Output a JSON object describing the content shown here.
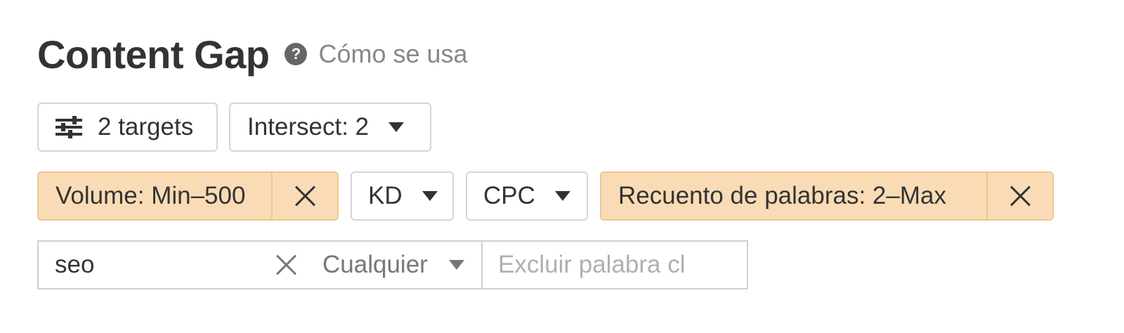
{
  "header": {
    "title": "Content Gap",
    "help_icon": "question-circle-icon",
    "help_label": "Cómo se usa"
  },
  "toolbar": {
    "targets_icon": "sliders-icon",
    "targets_label": "2 targets",
    "intersect_label": "Intersect: 2"
  },
  "filters": {
    "volume_label": "Volume: Min–500",
    "kd_label": "KD",
    "cpc_label": "CPC",
    "word_count_label": "Recuento de palabras: 2–Max"
  },
  "search": {
    "keyword_value": "seo",
    "mode_label": "Cualquier",
    "exclude_placeholder": "Excluir palabra cl"
  },
  "colors": {
    "active_chip_bg": "#f9dcb6",
    "active_chip_border": "#f0c58f",
    "text": "#333333"
  }
}
